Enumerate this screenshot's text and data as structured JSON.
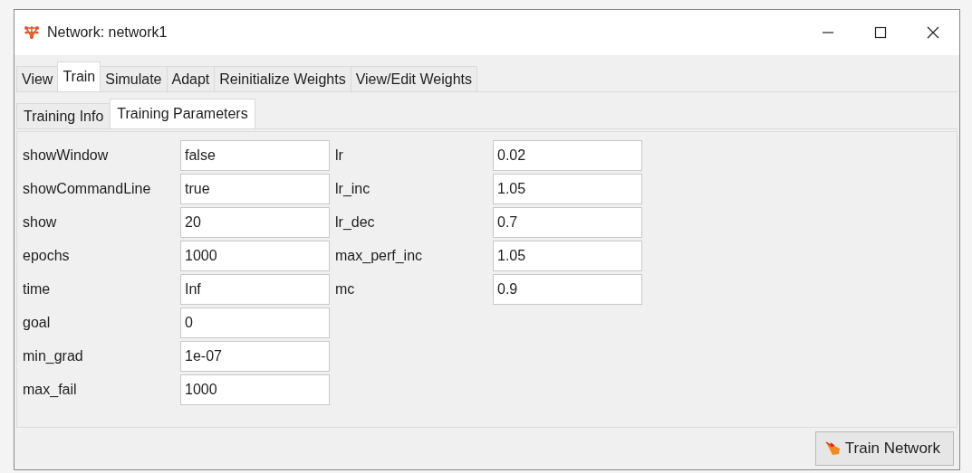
{
  "window": {
    "title": "Network: network1"
  },
  "tabs": [
    {
      "label": "View",
      "selected": false
    },
    {
      "label": "Train",
      "selected": true
    },
    {
      "label": "Simulate",
      "selected": false
    },
    {
      "label": "Adapt",
      "selected": false
    },
    {
      "label": "Reinitialize Weights",
      "selected": false
    },
    {
      "label": "View/Edit Weights",
      "selected": false
    }
  ],
  "subtabs": [
    {
      "label": "Training Info",
      "selected": false
    },
    {
      "label": "Training Parameters",
      "selected": true
    }
  ],
  "parameters_left": [
    {
      "label": "showWindow",
      "value": "false"
    },
    {
      "label": "showCommandLine",
      "value": "true"
    },
    {
      "label": "show",
      "value": "20"
    },
    {
      "label": "epochs",
      "value": "1000"
    },
    {
      "label": "time",
      "value": "Inf"
    },
    {
      "label": "goal",
      "value": "0"
    },
    {
      "label": "min_grad",
      "value": "1e-07"
    },
    {
      "label": "max_fail",
      "value": "1000"
    }
  ],
  "parameters_right": [
    {
      "label": "lr",
      "value": "0.02"
    },
    {
      "label": "lr_inc",
      "value": "1.05"
    },
    {
      "label": "lr_dec",
      "value": "0.7"
    },
    {
      "label": "max_perf_inc",
      "value": "1.05"
    },
    {
      "label": "mc",
      "value": "0.9"
    }
  ],
  "train_button": {
    "label": "Train Network"
  }
}
